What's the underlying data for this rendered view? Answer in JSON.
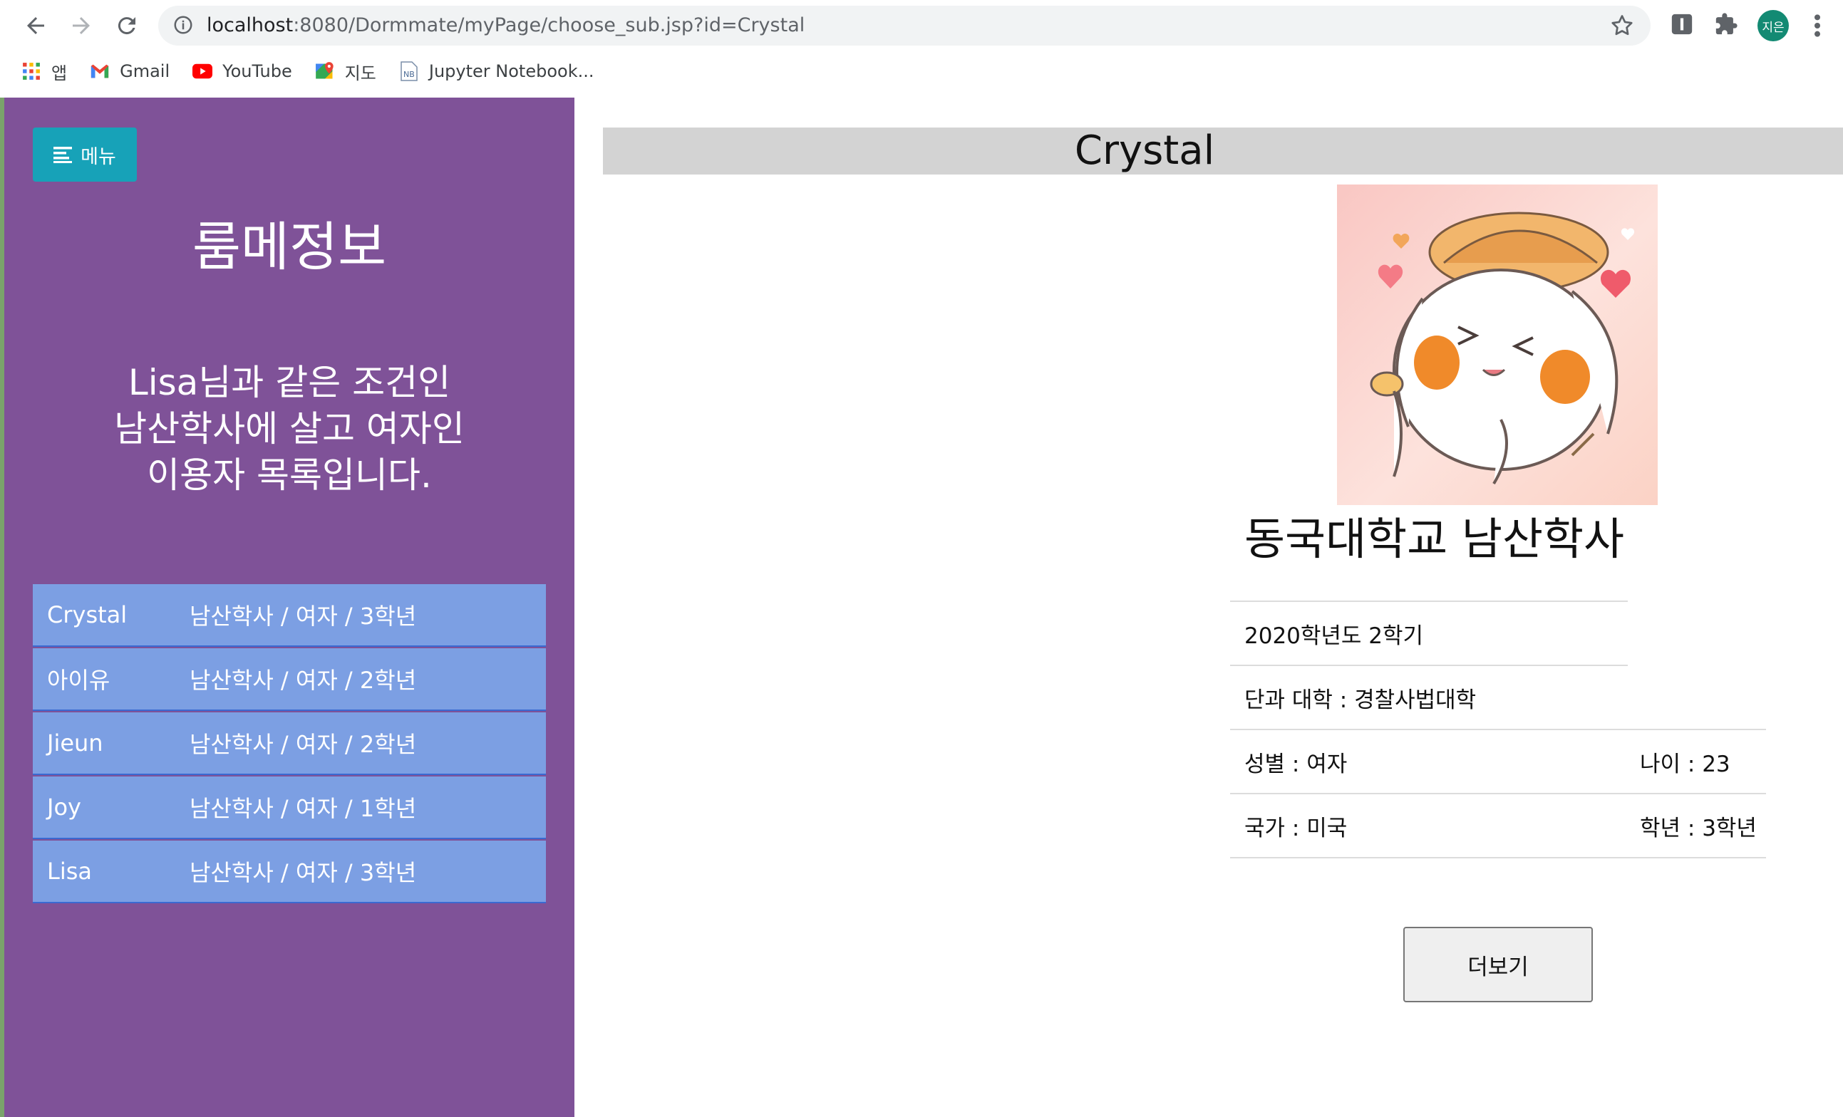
{
  "browser": {
    "url_host": "localhost",
    "url_rest": ":8080/Dormmate/myPage/choose_sub.jsp?id=Crystal",
    "profile_initials": "지은",
    "bookmarks": [
      {
        "label": "앱",
        "icon": "apps-grid-icon"
      },
      {
        "label": "Gmail",
        "icon": "gmail-icon"
      },
      {
        "label": "YouTube",
        "icon": "youtube-icon"
      },
      {
        "label": "지도",
        "icon": "maps-icon"
      },
      {
        "label": "Jupyter Notebook...",
        "icon": "jupyter-icon"
      }
    ]
  },
  "sidebar": {
    "menu_label": "메뉴",
    "title": "룸메정보",
    "message_lines": [
      "Lisa님과 같은 조건인",
      "남산학사에 살고 여자인",
      "이용자 목록입니다."
    ],
    "users": [
      {
        "name": "Crystal",
        "info": "남산학사 / 여자 / 3학년"
      },
      {
        "name": "아이유",
        "info": "남산학사 / 여자 / 2학년"
      },
      {
        "name": "Jieun",
        "info": "남산학사 / 여자 / 2학년"
      },
      {
        "name": "Joy",
        "info": "남산학사 / 여자 / 1학년"
      },
      {
        "name": "Lisa",
        "info": "남산학사 / 여자 / 3학년"
      }
    ]
  },
  "profile": {
    "name": "Crystal",
    "university": "동국대학교 남산학사",
    "semester": "2020학년도 2학기",
    "college": "단과 대학 : 경찰사법대학",
    "gender": "성별 : 여자",
    "age": "나이 : 23",
    "country": "국가 : 미국",
    "grade": "학년 : 3학년",
    "more_label": "더보기"
  },
  "colors": {
    "sidebar_bg": "#7f5298",
    "menu_button": "#17a2b8",
    "list_row": "#7c9fe3",
    "list_border": "#3a69d1",
    "name_bar": "#d3d3d3"
  }
}
